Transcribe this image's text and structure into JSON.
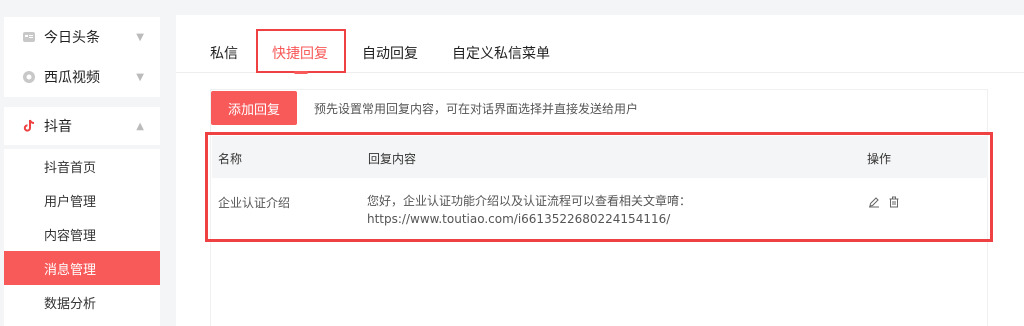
{
  "sidebar": {
    "toutiao_label": "今日头条",
    "xigua_label": "西瓜视频",
    "douyin_label": "抖音",
    "douyin_items": [
      "抖音首页",
      "用户管理",
      "内容管理",
      "消息管理",
      "数据分析"
    ],
    "active_item": "消息管理",
    "accent": "#f85959"
  },
  "tabs": [
    "私信",
    "快捷回复",
    "自动回复",
    "自定义私信菜单"
  ],
  "active_tab": "快捷回复",
  "toolbar": {
    "add_label": "添加回复",
    "hint": "预先设置常用回复内容，可在对话界面选择并直接发送给用户"
  },
  "table": {
    "headers": {
      "name": "名称",
      "content": "回复内容",
      "actions": "操作"
    },
    "rows": [
      {
        "name": "企业认证介绍",
        "content_line1": "您好，企业认证功能介绍以及认证流程可以查看相关文章唷：",
        "content_line2": "https://www.toutiao.com/i6613522680224154116/",
        "icons": [
          "edit-icon",
          "delete-icon"
        ]
      }
    ]
  }
}
